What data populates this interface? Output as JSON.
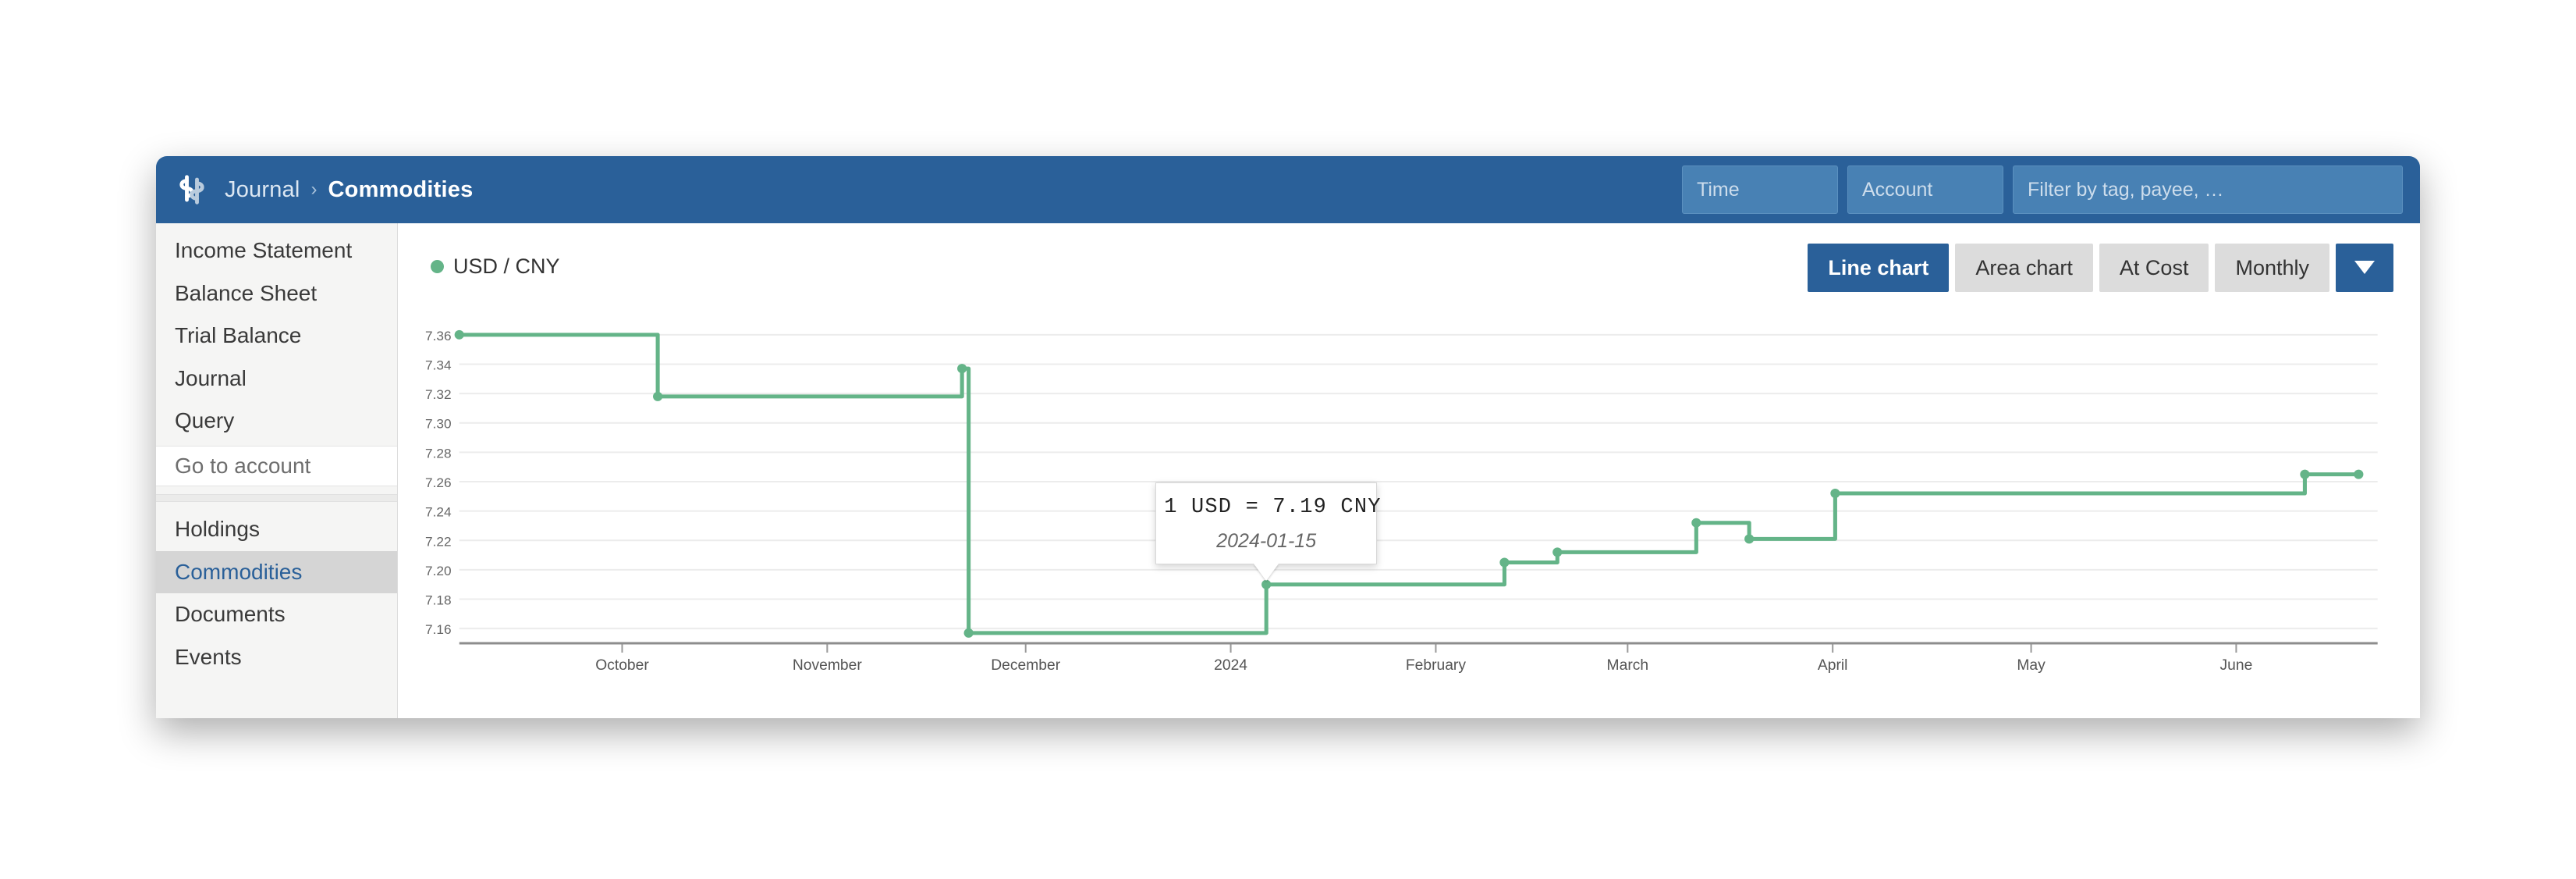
{
  "header": {
    "logo_icon": "fava-dollar-heart-logo",
    "breadcrumb": {
      "parent": "Journal",
      "separator": "›",
      "current": "Commodities"
    },
    "time_placeholder": "Time",
    "account_placeholder": "Account",
    "filter_placeholder": "Filter by tag, payee, …",
    "time_value": "",
    "account_value": "",
    "filter_value": "",
    "background_color": "#2a6099"
  },
  "sidebar": {
    "group_one": [
      {
        "label": "Income Statement",
        "selected": false
      },
      {
        "label": "Balance Sheet",
        "selected": false
      },
      {
        "label": "Trial Balance",
        "selected": false
      },
      {
        "label": "Journal",
        "selected": false
      },
      {
        "label": "Query",
        "selected": false
      }
    ],
    "go_to_account_placeholder": "Go to account",
    "go_to_account_value": "",
    "group_two": [
      {
        "label": "Holdings",
        "selected": false
      },
      {
        "label": "Commodities",
        "selected": true
      },
      {
        "label": "Documents",
        "selected": false
      },
      {
        "label": "Events",
        "selected": false
      }
    ],
    "selected_color": "#2a6099"
  },
  "toolbar": {
    "buttons": [
      {
        "label": "Line chart",
        "active": true
      },
      {
        "label": "Area chart",
        "active": false
      },
      {
        "label": "At Cost",
        "active": false
      },
      {
        "label": "Monthly",
        "active": false
      }
    ],
    "dropdown_icon": "chevron-down-icon"
  },
  "legend": {
    "label": "USD / CNY",
    "color": "#64b488"
  },
  "tooltip": {
    "value_line": "1 USD = 7.19 CNY",
    "date_line": "2024-01-15"
  },
  "chart_data": {
    "type": "line",
    "title": "USD / CNY",
    "xlabel": "",
    "ylabel": "",
    "interpolation": "step-after",
    "grid": true,
    "legend_position": "top-left",
    "ylim": [
      7.15,
      7.37
    ],
    "yticks": [
      7.36,
      7.34,
      7.32,
      7.3,
      7.28,
      7.26,
      7.24,
      7.22,
      7.2,
      7.18,
      7.16
    ],
    "xtick_labels": [
      "October",
      "November",
      "December",
      "2024",
      "February",
      "March",
      "April",
      "May",
      "June"
    ],
    "series": [
      {
        "name": "USD / CNY",
        "color": "#64b488",
        "points": [
          {
            "date": "2023-09-15",
            "value": 7.36
          },
          {
            "date": "2023-10-15",
            "value": 7.318
          },
          {
            "date": "2023-11-30",
            "value": 7.337
          },
          {
            "date": "2023-12-01",
            "value": 7.157
          },
          {
            "date": "2024-01-15",
            "value": 7.19
          },
          {
            "date": "2024-02-20",
            "value": 7.205
          },
          {
            "date": "2024-02-28",
            "value": 7.212
          },
          {
            "date": "2024-03-20",
            "value": 7.232
          },
          {
            "date": "2024-03-28",
            "value": 7.221
          },
          {
            "date": "2024-04-10",
            "value": 7.252
          },
          {
            "date": "2024-06-20",
            "value": 7.265
          }
        ]
      }
    ]
  }
}
